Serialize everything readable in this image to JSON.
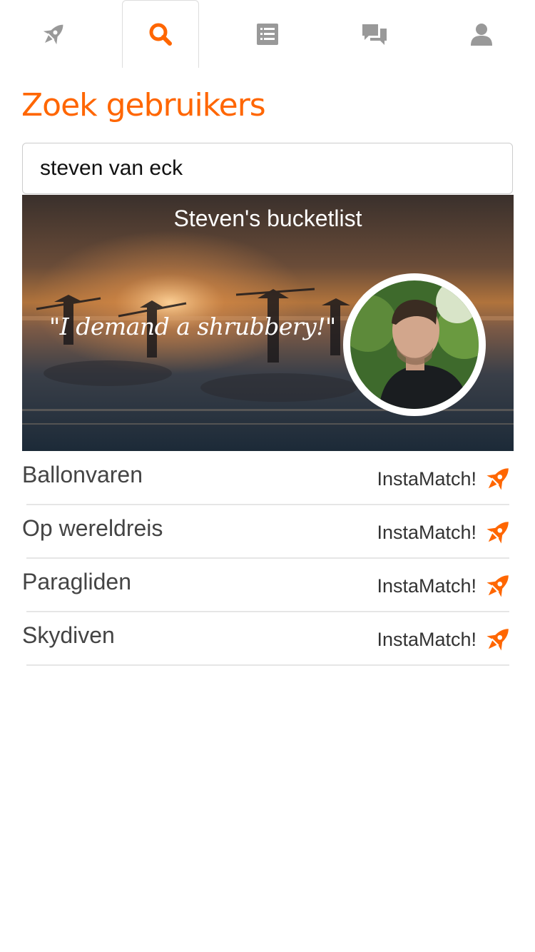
{
  "tabs": [
    {
      "name": "rocket-icon",
      "active": false
    },
    {
      "name": "search-icon",
      "active": true
    },
    {
      "name": "list-icon",
      "active": false
    },
    {
      "name": "chat-icon",
      "active": false
    },
    {
      "name": "user-icon",
      "active": false
    }
  ],
  "colors": {
    "accent": "#ff6600",
    "tab_inactive": "#999999"
  },
  "page": {
    "title": "Zoek gebruikers"
  },
  "search": {
    "value": "steven van eck"
  },
  "banner": {
    "title": "Steven's bucketlist",
    "quote": "\"I demand a shrubbery!\""
  },
  "bucketlist": [
    {
      "label": "Ballonvaren",
      "action": "InstaMatch!",
      "action_icon": "rocket-icon"
    },
    {
      "label": "Op wereldreis",
      "action": "InstaMatch!",
      "action_icon": "rocket-icon"
    },
    {
      "label": "Paragliden",
      "action": "InstaMatch!",
      "action_icon": "rocket-icon"
    },
    {
      "label": "Skydiven",
      "action": "InstaMatch!",
      "action_icon": "rocket-icon"
    }
  ]
}
